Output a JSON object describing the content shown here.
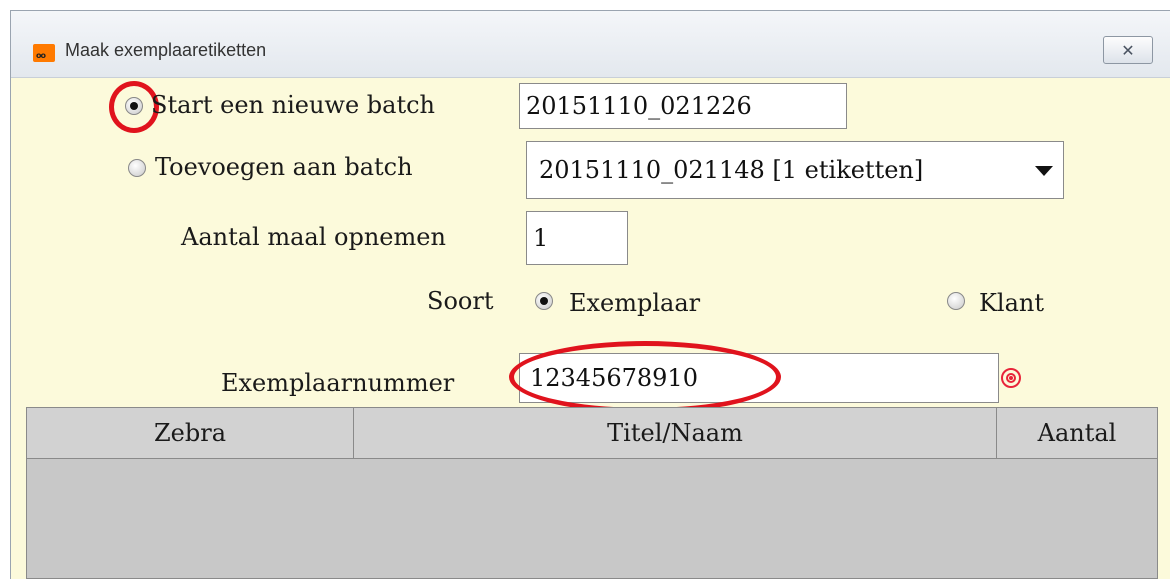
{
  "window": {
    "title": "Maak exemplaaretiketten",
    "icon": "app-logo-icon",
    "close_label": "✕"
  },
  "batch": {
    "new_batch_label": "Start een nieuwe batch",
    "new_batch_selected": true,
    "new_batch_value": "20151110_021226",
    "add_to_batch_label": "Toevoegen aan batch",
    "add_to_batch_selected": false,
    "existing_batch_value": "20151110_021148 [1 etiketten]"
  },
  "copies": {
    "label": "Aantal maal opnemen",
    "value": "1"
  },
  "type": {
    "label": "Soort",
    "options": [
      {
        "label": "Exemplaar",
        "selected": true
      },
      {
        "label": "Klant",
        "selected": false
      }
    ]
  },
  "item_number": {
    "label": "Exemplaarnummer",
    "value": "12345678910"
  },
  "table": {
    "columns": [
      "Zebra",
      "Titel/Naam",
      "Aantal"
    ],
    "rows": []
  },
  "colors": {
    "panel_bg": "#fcfadb",
    "highlight": "#e0131d",
    "table_bg": "#c8c8c8"
  }
}
